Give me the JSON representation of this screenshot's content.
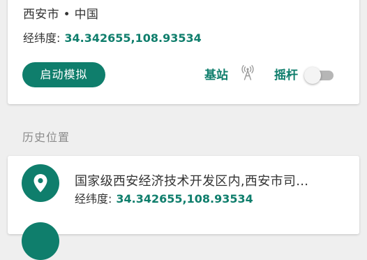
{
  "current": {
    "location": "西安市 • 中国",
    "coord_label": "经纬度:",
    "coord_value": "34.342655,108.93534"
  },
  "actions": {
    "start_label": "启动模拟",
    "station_label": "基站",
    "station_icon": "cell-tower-icon",
    "joystick_label": "摇杆",
    "joystick_toggle": "off"
  },
  "history": {
    "section_title": "历史位置",
    "items": [
      {
        "icon": "location-pin-icon",
        "name": "国家级西安经济技术开发区内,西安市司…",
        "coord_label": "经纬度:",
        "coord_value": "34.342655,108.93534"
      }
    ]
  },
  "colors": {
    "accent": "#0f7e6c",
    "background": "#efefef",
    "card": "#ffffff"
  }
}
